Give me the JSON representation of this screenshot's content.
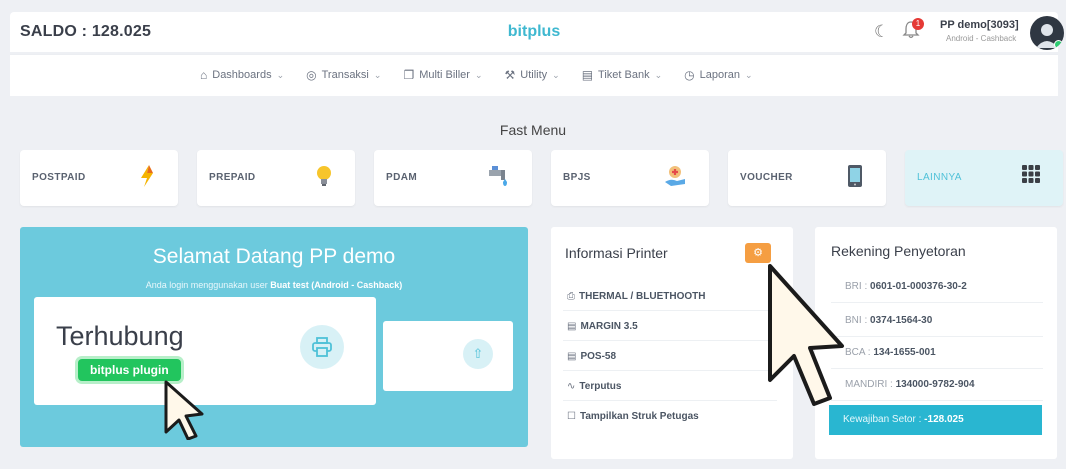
{
  "header": {
    "saldo": "SALDO : 128.025",
    "brand": "bitplus",
    "notification_count": "1",
    "user_name": "PP demo[3093]",
    "user_role": "Android - Cashback"
  },
  "nav": [
    {
      "label": "Dashboards",
      "icon": "home-icon"
    },
    {
      "label": "Transaksi",
      "icon": "globe-icon"
    },
    {
      "label": "Multi Biller",
      "icon": "copy-icon"
    },
    {
      "label": "Utility",
      "icon": "wrench-icon"
    },
    {
      "label": "Tiket Bank",
      "icon": "ticket-icon"
    },
    {
      "label": "Laporan",
      "icon": "clock-icon"
    }
  ],
  "fast_menu": {
    "title": "Fast Menu",
    "items": [
      {
        "label": "POSTPAID",
        "icon": "lightning-icon"
      },
      {
        "label": "PREPAID",
        "icon": "bulb-icon"
      },
      {
        "label": "PDAM",
        "icon": "faucet-icon"
      },
      {
        "label": "BPJS",
        "icon": "health-hand-icon"
      },
      {
        "label": "VOUCHER",
        "icon": "phone-icon"
      },
      {
        "label": "LAINNYA",
        "icon": "grid-icon"
      }
    ]
  },
  "welcome": {
    "title": "Selamat Datang PP demo",
    "sub_prefix": "Anda login menggunakan user",
    "sub_user": "Buat test (Android - Cashback)",
    "status": "Terhubung",
    "plugin": "bitplus plugin"
  },
  "printer": {
    "title": "Informasi Printer",
    "rows": [
      "THERMAL / BLUETHOOTH",
      "MARGIN 3.5",
      "POS-58",
      "Terputus"
    ],
    "checkbox_label": "Tampilkan Struk Petugas"
  },
  "rekening": {
    "title": "Rekening Penyetoran",
    "rows": [
      {
        "bank": "BRI :",
        "number": "0601-01-000376-30-2"
      },
      {
        "bank": "BNI :",
        "number": "0374-1564-30"
      },
      {
        "bank": "BCA :",
        "number": "134-1655-001"
      },
      {
        "bank": "MANDIRI :",
        "number": "134000-9782-904"
      }
    ],
    "due_label": "Kewajiban Setor :",
    "due_value": "-128.025"
  },
  "colors": {
    "accent": "#4fc1d8",
    "welcome_bg": "#6ccadd",
    "success": "#22c55e",
    "warning": "#f59e42",
    "due_bg": "#29b6d1"
  }
}
